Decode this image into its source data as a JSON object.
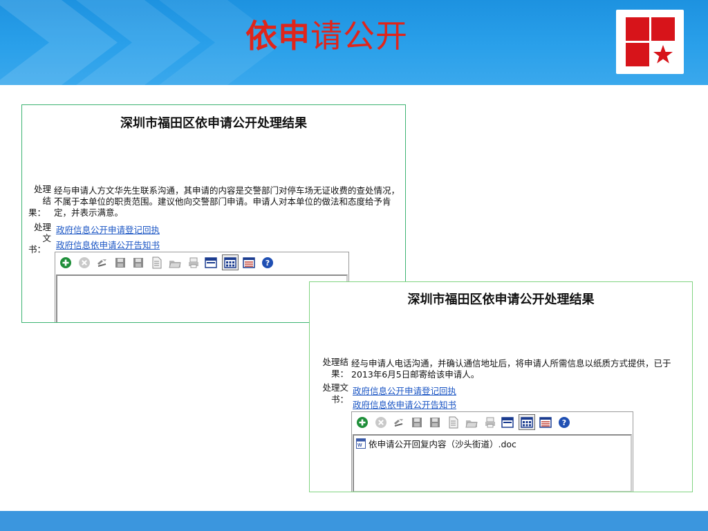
{
  "header": {
    "title_strong": "依申",
    "title_rest": "请公开"
  },
  "colors": {
    "header_blue": "#2aa0ea",
    "title_red": "#e0251b",
    "logo_red": "#d7141a",
    "footer_blue": "#3b96de",
    "panel_border": "#3cb371",
    "link": "#1a55c4"
  },
  "panel1": {
    "title": "深圳市福田区依申请公开处理结果",
    "result_label_a": "处理",
    "result_label_b": "结",
    "result_label_c": "果：",
    "result_text": "经与申请人方文华先生联系沟通，其申请的内容是交警部门对停车场无证收费的查处情况，不属于本单位的职责范围。建议他向交警部门申请。申请人对本单位的做法和态度给予肯定，并表示满意。",
    "doc_label_a": "处理",
    "doc_label_b": "文",
    "doc_label_c": "书：",
    "link1": "政府信息公开申请登记回执",
    "link2": "政府信息依申请公开告知书"
  },
  "panel2": {
    "title": "深圳市福田区依申请公开处理结果",
    "result_label_a": "处理结",
    "result_label_b": "果：",
    "result_text": "经与申请人电话沟通，并确认通信地址后，将申请人所需信息以纸质方式提供，已于2013年6月5日邮寄给该申请人。",
    "doc_label_a": "处理文",
    "doc_label_b": "书：",
    "link1": "政府信息公开申请登记回执",
    "link2": "政府信息依申请公开告知书",
    "file_name": "依申请公开回复内容（沙头街道）.doc"
  },
  "toolbar_icons": [
    "add-icon",
    "delete-icon",
    "tools-icon",
    "save-icon",
    "save-as-icon",
    "document-icon",
    "open-folder-icon",
    "print-icon",
    "window-icon",
    "thumbnail-view-icon",
    "list-view-icon",
    "help-icon"
  ]
}
